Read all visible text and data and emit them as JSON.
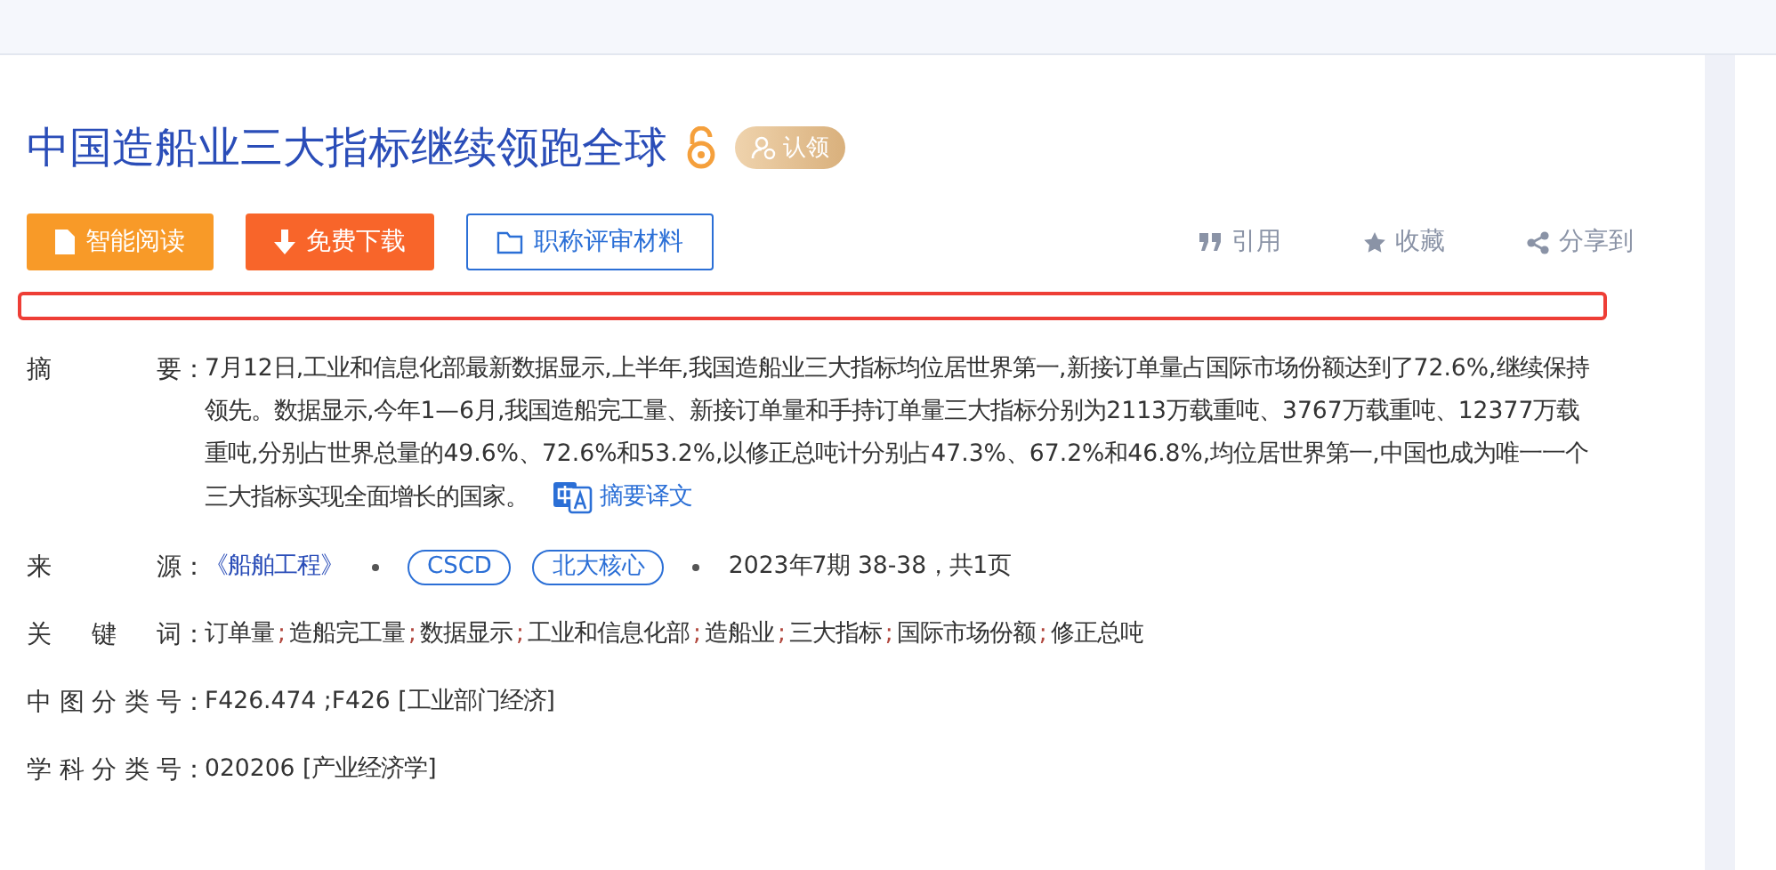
{
  "title": "中国造船业三大指标继续领跑全球",
  "claim_badge": "认领",
  "actions": [
    {
      "kind": "read",
      "label": "智能阅读"
    },
    {
      "kind": "download",
      "label": "免费下载"
    },
    {
      "kind": "folder",
      "label": "职称评审材料"
    }
  ],
  "tools": [
    {
      "kind": "quote",
      "label": "引用"
    },
    {
      "kind": "star",
      "label": "收藏"
    },
    {
      "kind": "share",
      "label": "分享到"
    }
  ],
  "abstract": {
    "label": "摘要：",
    "text": "7月12日,工业和信息化部最新数据显示,上半年,我国造船业三大指标均位居世界第一,新接订单量占国际市场份额达到了72.6%,继续保持领先。数据显示,今年1—6月,我国造船完工量、新接订单量和手持订单量三大指标分别为2113万载重吨、3767万载重吨、12377万载重吨,分别占世界总量的49.6%、72.6%和53.2%,以修正总吨计分别占47.3%、67.2%和46.8%,均位居世界第一,中国也成为唯一一个三大指标实现全面增长的国家。",
    "translate_link": "摘要译文"
  },
  "source": {
    "label": "来源：",
    "journal": "《船舶工程》",
    "tags": [
      "CSCD",
      "北大核心"
    ],
    "issue": "2023年7期 38-38，共1页"
  },
  "keywords": {
    "label": "关键词：",
    "separator": ";",
    "items": [
      "订单量",
      "造船完工量",
      "数据显示",
      "工业和信息化部",
      "造船业",
      "三大指标",
      "国际市场份额",
      "修正总吨"
    ]
  },
  "clc": {
    "label": "中图分类号：",
    "value": "F426.474 ;F426 [工业部门经济]"
  },
  "subject": {
    "label": "学科分类号：",
    "value": "020206 [产业经济学]"
  }
}
